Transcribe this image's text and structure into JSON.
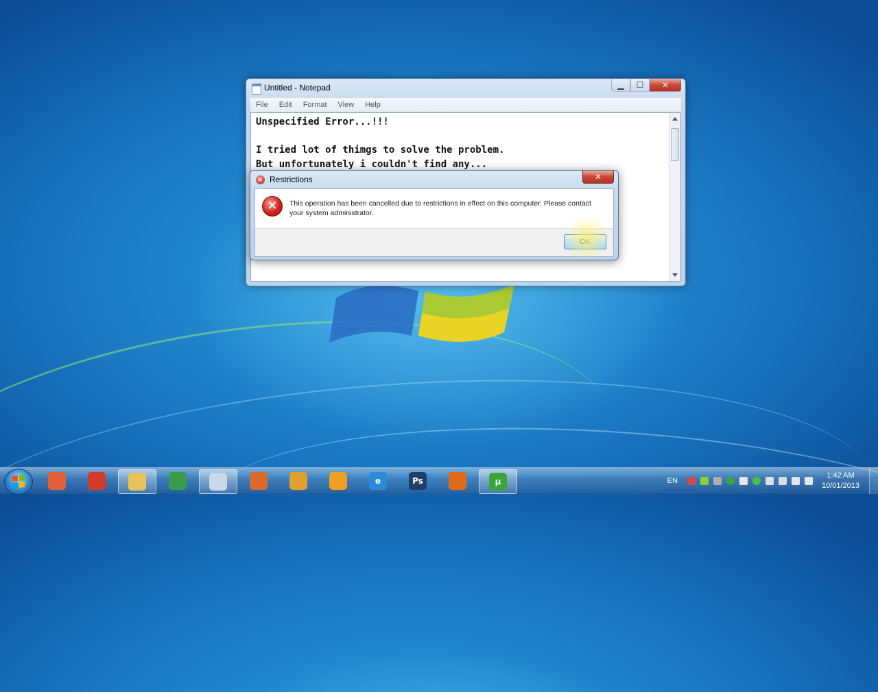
{
  "notepad": {
    "title": "Untitled - Notepad",
    "menu": [
      "File",
      "Edit",
      "Format",
      "View",
      "Help"
    ],
    "content": "Unspecified Error...!!!\n\nI tried lot of thimgs to solve the problem.\nBut unfortunately i couldn't find any...\n\n\n\n\n\n3. personolize option is working or not..?",
    "caption_buttons": {
      "minimize": "▁",
      "maximize": "☐",
      "close": "✕"
    }
  },
  "dialog": {
    "title": "Restrictions",
    "message": "This operation has been cancelled due to restrictions in effect on this computer. Please contact your system administrator.",
    "ok_label": "OK",
    "close_glyph": "✕",
    "icon_glyph": "✕",
    "title_icon_glyph": "×"
  },
  "taskbar": {
    "items": [
      {
        "name": "paint-icon",
        "color": "#e0603a",
        "glyph": ""
      },
      {
        "name": "ccleaner-icon",
        "color": "#d43a2a",
        "glyph": ""
      },
      {
        "name": "explorer-icon",
        "color": "#e8c25a",
        "glyph": ""
      },
      {
        "name": "chrome-icon",
        "color": "#3a9a4a",
        "glyph": ""
      },
      {
        "name": "notepad-icon",
        "color": "#c9d7e6",
        "glyph": ""
      },
      {
        "name": "tasklist-icon",
        "color": "#d96a2c",
        "glyph": ""
      },
      {
        "name": "app-icon",
        "color": "#e0a030",
        "glyph": ""
      },
      {
        "name": "folder-app-icon",
        "color": "#f0a020",
        "glyph": ""
      },
      {
        "name": "ie-icon",
        "color": "#2a8ad8",
        "glyph": "e"
      },
      {
        "name": "photoshop-icon",
        "color": "#1d3f6e",
        "glyph": "Ps"
      },
      {
        "name": "firefox-icon",
        "color": "#e06a1a",
        "glyph": ""
      },
      {
        "name": "utorrent-icon",
        "color": "#3aa63a",
        "glyph": "µ"
      }
    ],
    "language": "EN",
    "time": "1:42 AM",
    "date": "10/01/2013"
  },
  "colors": {
    "titlebar": "#c3d8ee",
    "close_red": "#c9483a",
    "desktop_blue": "#1a78c4",
    "error_red": "#d1231a"
  }
}
